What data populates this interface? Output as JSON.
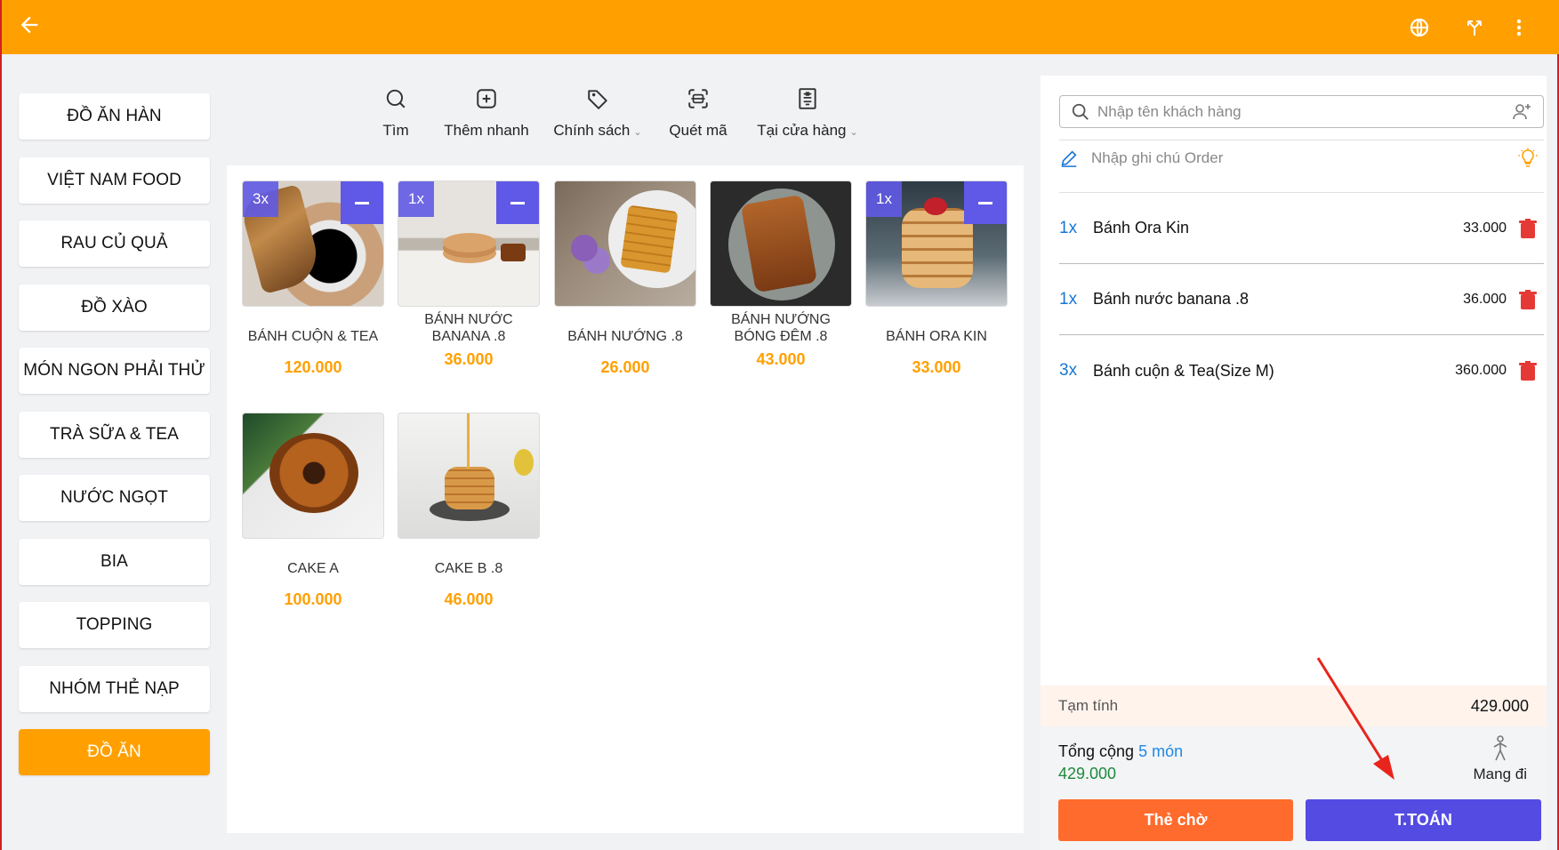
{
  "colors": {
    "accent": "#ffa000",
    "primary": "#534be2",
    "wait": "#ff6b2c",
    "price": "#ffa000",
    "total": "#1b8a3b",
    "delete": "#e53935"
  },
  "topbar": {
    "back_icon": "arrow-left-icon",
    "icons": [
      "globe-icon",
      "branch-icon",
      "more-vertical-icon"
    ]
  },
  "categories": [
    {
      "label": "ĐỒ ĂN HÀN",
      "active": false
    },
    {
      "label": "VIỆT NAM FOOD",
      "active": false
    },
    {
      "label": "RAU CỦ QUẢ",
      "active": false
    },
    {
      "label": "ĐỒ XÀO",
      "active": false
    },
    {
      "label": "MÓN NGON PHẢI THỬ",
      "active": false
    },
    {
      "label": "TRÀ SỮA & TEA",
      "active": false
    },
    {
      "label": "NƯỚC NGỌT",
      "active": false
    },
    {
      "label": "BIA",
      "active": false
    },
    {
      "label": "TOPPING",
      "active": false
    },
    {
      "label": "NHÓM THẺ NẠP",
      "active": false
    },
    {
      "label": "ĐỒ ĂN",
      "active": true
    }
  ],
  "toolbar": {
    "search": "Tìm",
    "quick_add": "Thêm nhanh",
    "policy": "Chính sách",
    "scan": "Quét mã",
    "store": "Tại cửa hàng"
  },
  "products": [
    {
      "name": "BÁNH CUỘN & TEA",
      "price": "120.000",
      "qty": "3x"
    },
    {
      "name": "BÁNH NƯỚC BANANA .8",
      "price": "36.000",
      "qty": "1x"
    },
    {
      "name": "BÁNH NƯỚNG .8",
      "price": "26.000",
      "qty": ""
    },
    {
      "name": "BÁNH NƯỚNG BÓNG ĐÊM .8",
      "price": "43.000",
      "qty": ""
    },
    {
      "name": "BÁNH ORA KIN",
      "price": "33.000",
      "qty": "1x"
    },
    {
      "name": "CAKE A",
      "price": "100.000",
      "qty": ""
    },
    {
      "name": "CAKE B  .8",
      "price": "46.000",
      "qty": ""
    }
  ],
  "order": {
    "customer_placeholder": "Nhập tên khách hàng",
    "note_placeholder": "Nhập ghi chú Order",
    "items": [
      {
        "qty": "1x",
        "name": "Bánh Ora Kin",
        "price": "33.000"
      },
      {
        "qty": "1x",
        "name": "Bánh nước banana .8",
        "price": "36.000"
      },
      {
        "qty": "3x",
        "name": "Bánh cuộn & Tea(Size M)",
        "price": "360.000"
      }
    ],
    "subtotal_label": "Tạm tính",
    "subtotal_value": "429.000",
    "total_label": "Tổng cộng",
    "total_count": "5 món",
    "total_value": "429.000",
    "takeaway_label": "Mang đi",
    "wait_button": "Thẻ chờ",
    "pay_button": "T.TOÁN"
  }
}
